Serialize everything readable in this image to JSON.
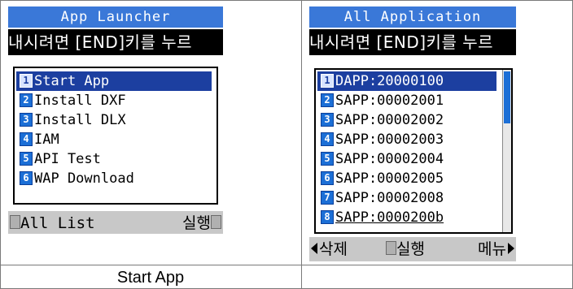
{
  "left_screen": {
    "title": "App Launcher",
    "marquee": "내시려면 [END]키를 누르",
    "items": [
      {
        "num": "1",
        "label": "Start App",
        "selected": true
      },
      {
        "num": "2",
        "label": "Install DXF"
      },
      {
        "num": "3",
        "label": "Install DLX"
      },
      {
        "num": "4",
        "label": "IAM"
      },
      {
        "num": "5",
        "label": "API Test"
      },
      {
        "num": "6",
        "label": "WAP Download"
      }
    ],
    "softkey_left": "All List",
    "softkey_right": "실행"
  },
  "right_screen": {
    "title": "All Application",
    "marquee": "내시려면 [END]키를 누르",
    "items": [
      {
        "num": "1",
        "label": "DAPP:20000100",
        "selected": true
      },
      {
        "num": "2",
        "label": "SAPP:00002001"
      },
      {
        "num": "3",
        "label": "SAPP:00002002"
      },
      {
        "num": "4",
        "label": "SAPP:00002003"
      },
      {
        "num": "5",
        "label": "SAPP:00002004"
      },
      {
        "num": "6",
        "label": "SAPP:00002005"
      },
      {
        "num": "7",
        "label": "SAPP:00002008"
      },
      {
        "num": "8",
        "label": "SAPP:0000200b"
      }
    ],
    "softkey_left": "삭제",
    "softkey_center": "실행",
    "softkey_right": "메뉴"
  },
  "captions": {
    "left": "Start App",
    "right": ""
  }
}
